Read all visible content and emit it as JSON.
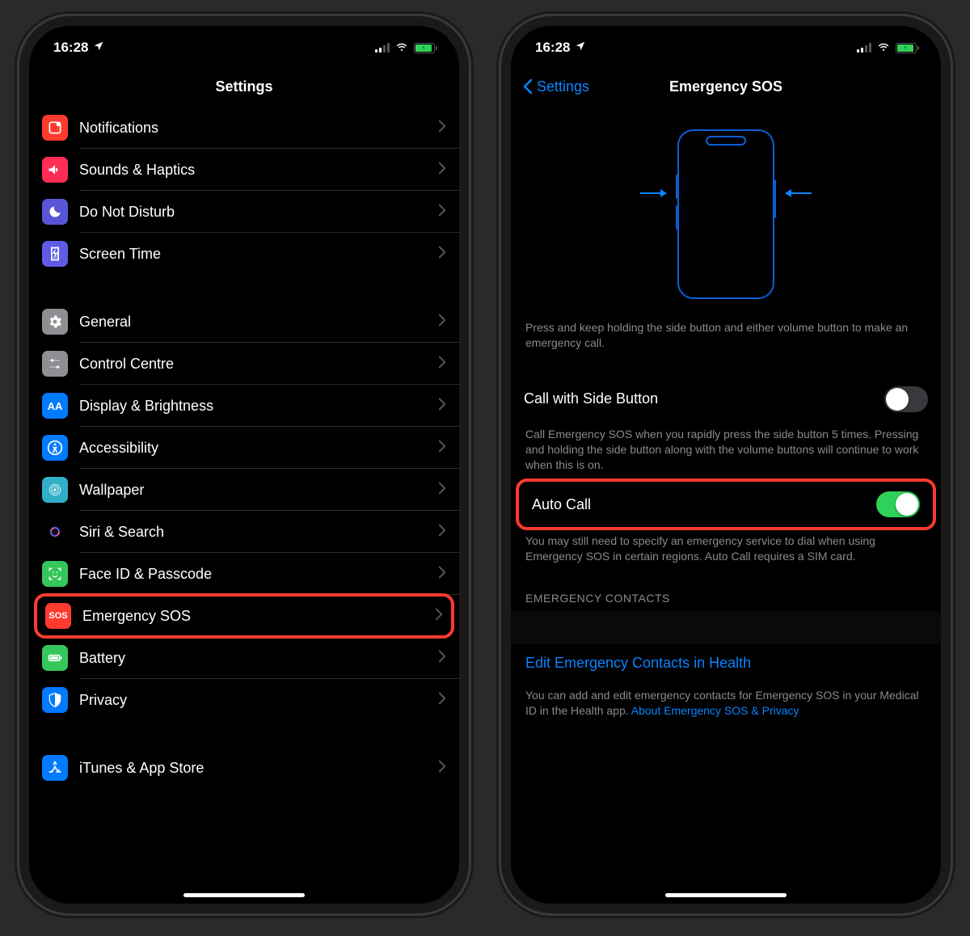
{
  "status": {
    "time": "16:28"
  },
  "left": {
    "title": "Settings",
    "group1": [
      {
        "name": "notifications",
        "label": "Notifications",
        "bg": "bg-red"
      },
      {
        "name": "sounds-haptics",
        "label": "Sounds & Haptics",
        "bg": "bg-pink"
      },
      {
        "name": "do-not-disturb",
        "label": "Do Not Disturb",
        "bg": "bg-purple"
      },
      {
        "name": "screen-time",
        "label": "Screen Time",
        "bg": "bg-indigo"
      }
    ],
    "group2": [
      {
        "name": "general",
        "label": "General",
        "bg": "bg-gray"
      },
      {
        "name": "control-centre",
        "label": "Control Centre",
        "bg": "bg-gray"
      },
      {
        "name": "display-brightness",
        "label": "Display & Brightness",
        "bg": "bg-blue",
        "txt": "AA"
      },
      {
        "name": "accessibility",
        "label": "Accessibility",
        "bg": "bg-blue"
      },
      {
        "name": "wallpaper",
        "label": "Wallpaper",
        "bg": "bg-teal"
      },
      {
        "name": "siri-search",
        "label": "Siri & Search",
        "bg": "bg-black"
      },
      {
        "name": "face-id-passcode",
        "label": "Face ID & Passcode",
        "bg": "bg-green"
      },
      {
        "name": "emergency-sos",
        "label": "Emergency SOS",
        "bg": "bg-red",
        "txt": "SOS",
        "highlight": true
      },
      {
        "name": "battery",
        "label": "Battery",
        "bg": "bg-green"
      },
      {
        "name": "privacy",
        "label": "Privacy",
        "bg": "bg-blue"
      }
    ],
    "group3": [
      {
        "name": "itunes-app-store",
        "label": "iTunes & App Store",
        "bg": "bg-blue"
      }
    ]
  },
  "right": {
    "back": "Settings",
    "title": "Emergency SOS",
    "hero_caption": "Press and keep holding the side button and either volume button to make an emergency call.",
    "call_side_label": "Call with Side Button",
    "call_side_on": false,
    "call_side_desc": "Call Emergency SOS when you rapidly press the side button 5 times. Pressing and holding the side button along with the volume buttons will continue to work when this is on.",
    "auto_call_label": "Auto Call",
    "auto_call_on": true,
    "auto_call_desc": "You may still need to specify an emergency service to dial when using Emergency SOS in certain regions. Auto Call requires a SIM card.",
    "contacts_header": "EMERGENCY CONTACTS",
    "edit_contacts": "Edit Emergency Contacts in Health",
    "contacts_desc": "You can add and edit emergency contacts for Emergency SOS in your Medical ID in the Health app. ",
    "privacy_link": "About Emergency SOS & Privacy"
  }
}
